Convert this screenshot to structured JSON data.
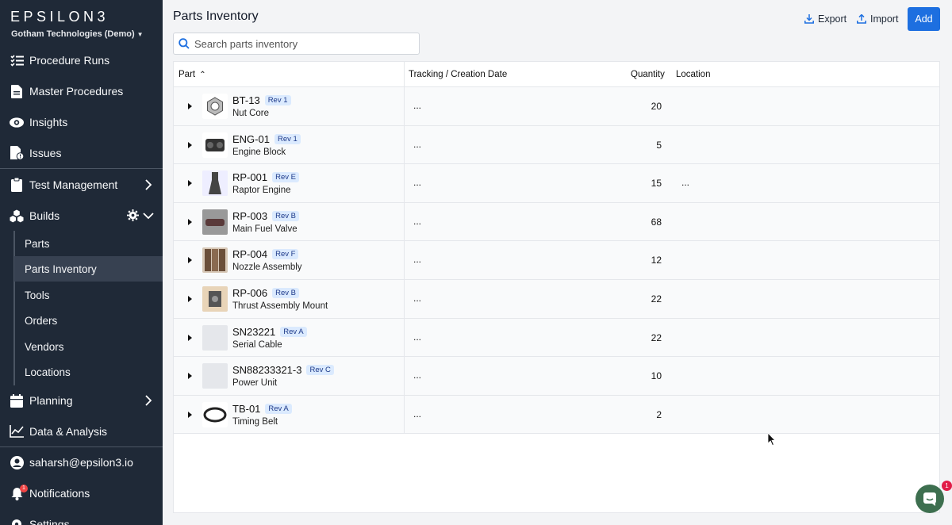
{
  "app": {
    "logo": "EPSILON3",
    "org": "Gotham Technologies (Demo)"
  },
  "sidebar": {
    "items": [
      {
        "label": "Procedure Runs",
        "icon": "checklist-icon"
      },
      {
        "label": "Master Procedures",
        "icon": "document-icon"
      },
      {
        "label": "Insights",
        "icon": "eye-icon"
      },
      {
        "label": "Issues",
        "icon": "issue-doc-icon"
      },
      {
        "label": "Test Management",
        "icon": "clipboard-icon"
      },
      {
        "label": "Builds",
        "icon": "cubes-icon"
      },
      {
        "label": "Planning",
        "icon": "calendar-icon"
      },
      {
        "label": "Data & Analysis",
        "icon": "chart-icon"
      },
      {
        "label": "saharsh@epsilon3.io",
        "icon": "user-icon"
      },
      {
        "label": "Notifications",
        "icon": "bell-icon"
      },
      {
        "label": "Settings",
        "icon": "gear-icon"
      }
    ],
    "builds_sub": [
      "Parts",
      "Parts Inventory",
      "Tools",
      "Orders",
      "Vendors",
      "Locations"
    ],
    "active_sub": "Parts Inventory",
    "notification_count": "1"
  },
  "main": {
    "title": "Parts Inventory",
    "export_label": "Export",
    "import_label": "Import",
    "add_label": "Add",
    "search_placeholder": "Search parts inventory"
  },
  "table": {
    "columns": [
      "Part",
      "Tracking / Creation Date",
      "Quantity",
      "Location"
    ],
    "sort_indicator": "^",
    "rows": [
      {
        "id": "BT-13",
        "rev": "Rev 1",
        "name": "Nut Core",
        "tracking": "...",
        "quantity": "20",
        "location": ""
      },
      {
        "id": "ENG-01",
        "rev": "Rev 1",
        "name": "Engine Block",
        "tracking": "...",
        "quantity": "5",
        "location": ""
      },
      {
        "id": "RP-001",
        "rev": "Rev E",
        "name": "Raptor Engine",
        "tracking": "...",
        "quantity": "15",
        "location": "..."
      },
      {
        "id": "RP-003",
        "rev": "Rev B",
        "name": "Main Fuel Valve",
        "tracking": "...",
        "quantity": "68",
        "location": ""
      },
      {
        "id": "RP-004",
        "rev": "Rev F",
        "name": "Nozzle Assembly",
        "tracking": "...",
        "quantity": "12",
        "location": ""
      },
      {
        "id": "RP-006",
        "rev": "Rev B",
        "name": "Thrust Assembly Mount",
        "tracking": "...",
        "quantity": "22",
        "location": ""
      },
      {
        "id": "SN23221",
        "rev": "Rev A",
        "name": "Serial Cable",
        "tracking": "...",
        "quantity": "22",
        "location": ""
      },
      {
        "id": "SN88233321-3",
        "rev": "Rev C",
        "name": "Power Unit",
        "tracking": "...",
        "quantity": "10",
        "location": ""
      },
      {
        "id": "TB-01",
        "rev": "Rev A",
        "name": "Timing Belt",
        "tracking": "...",
        "quantity": "2",
        "location": ""
      }
    ]
  },
  "chat": {
    "badge": "1"
  },
  "colors": {
    "sidebar_bg": "#1f2937",
    "accent": "#1d6fe0",
    "chat": "#3d6f4f"
  }
}
